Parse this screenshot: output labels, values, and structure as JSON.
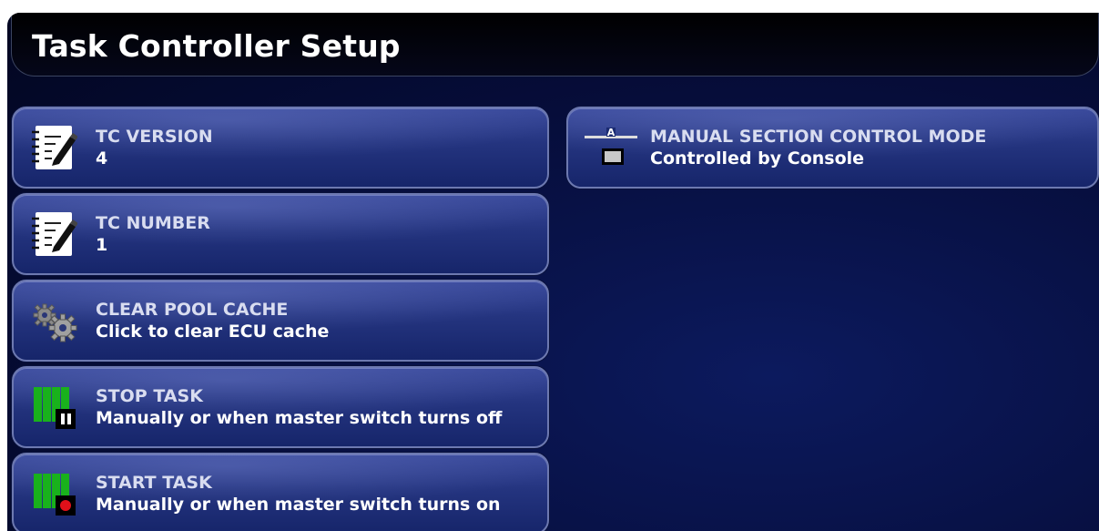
{
  "title": "Task Controller Setup",
  "tiles": [
    {
      "label": "TC VERSION",
      "value": "4",
      "icon": "notepad-edit-icon"
    },
    {
      "label": "TC NUMBER",
      "value": "1",
      "icon": "notepad-edit-icon"
    },
    {
      "label": "CLEAR POOL CACHE",
      "value": "Click to clear ECU cache",
      "icon": "gears-icon"
    },
    {
      "label": "STOP TASK",
      "value": "Manually or when master switch turns off",
      "icon": "stop-task-icon"
    },
    {
      "label": "START TASK",
      "value": "Manually or when master switch turns on",
      "icon": "start-task-icon"
    },
    {
      "label": "MANUAL SECTION CONTROL MODE",
      "value": "Controlled by Console",
      "icon": "section-control-icon",
      "icon_letter": "A"
    }
  ],
  "colors": {
    "background": "#060d3a",
    "tile": "#24347f",
    "tile_border": "#6d79b0",
    "green_bars": "#19b11c",
    "record_dot": "#e0101a"
  }
}
